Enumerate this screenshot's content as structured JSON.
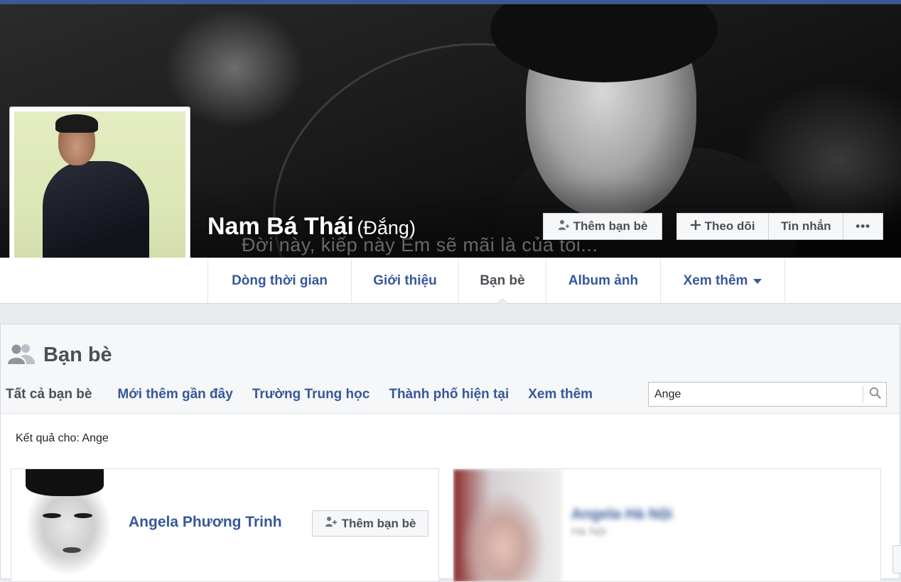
{
  "cover": {
    "caption": "Đời này, kiếp này Em sẽ mãi là của tôi..."
  },
  "profile": {
    "name": "Nam Bá Thái",
    "alternate_name": "(Đắng)",
    "add_friend_label": "Thêm bạn bè",
    "follow_label": "Theo dõi",
    "message_label": "Tin nhắn",
    "more_label": "•••"
  },
  "nav": {
    "tabs": [
      {
        "label": "Dòng thời gian"
      },
      {
        "label": "Giới thiệu"
      },
      {
        "label": "Bạn bè",
        "active": true
      },
      {
        "label": "Album ảnh"
      },
      {
        "label": "Xem thêm"
      }
    ]
  },
  "friends": {
    "title": "Bạn bè",
    "subtabs": [
      {
        "label": "Tất cả bạn bè",
        "active": true
      },
      {
        "label": "Mới thêm gần đây"
      },
      {
        "label": "Trường Trung học"
      },
      {
        "label": "Thành phố hiện tại"
      },
      {
        "label": "Xem thêm"
      }
    ],
    "search_value": "Ange",
    "results_label": "Kết quả cho: Ange",
    "results": [
      {
        "name": "Angela Phương Trinh",
        "action": "Thêm bạn bè"
      },
      {
        "name": "Angela Hà Nội",
        "subtitle": "Hà Nội"
      }
    ]
  },
  "colors": {
    "brand": "#3b5998",
    "link": "#365899",
    "text": "#4b4f56",
    "page_bg": "#e9ebee"
  },
  "icons": [
    "add-friend-icon",
    "plus-icon",
    "friends-icon",
    "search-icon",
    "caret-down-icon"
  ]
}
